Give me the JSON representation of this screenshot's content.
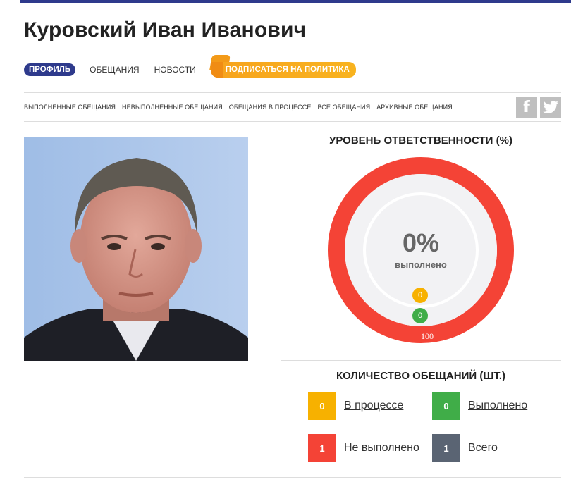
{
  "profile": {
    "name": "Куровский Иван Иванович"
  },
  "main_nav": {
    "active": "ПРОФИЛЬ",
    "items": [
      "ОБЕЩАНИЯ",
      "НОВОСТИ"
    ],
    "subscribe": "ПОДПИСАТЬСЯ НА ПОЛИТИКА"
  },
  "sub_nav": [
    "ВЫПОЛНЕННЫЕ ОБЕЩАНИЯ",
    "НЕВЫПОЛНЕННЫЕ ОБЕЩАНИЯ",
    "ОБЕЩАНИЯ В ПРОЦЕССЕ",
    "ВСЕ ОБЕЩАНИЯ",
    "АРХИВНЫЕ ОБЕЩАНИЯ"
  ],
  "social": {
    "facebook_icon": "facebook-icon",
    "twitter_icon": "twitter-icon"
  },
  "responsibility": {
    "title": "УРОВЕНЬ ОТВЕТСТВЕННОСТИ (%)",
    "percent": "0%",
    "percent_label": "выполнено",
    "in_process": "0",
    "done": "0",
    "not_done_share": "100"
  },
  "counts": {
    "title": "КОЛИЧЕСТВО ОБЕЩАНИЙ (ШТ.)",
    "in_process": {
      "value": "0",
      "label": "В процессе"
    },
    "done": {
      "value": "0",
      "label": "Выполнено"
    },
    "not_done": {
      "value": "1",
      "label": "Не выполнено"
    },
    "total": {
      "value": "1",
      "label": "Всего"
    }
  },
  "colors": {
    "brand": "#2e3a8c",
    "accent_orange": "#f7a31e",
    "in_process": "#f7b100",
    "done": "#40ad48",
    "not_done": "#f44336",
    "total": "#5a6473"
  }
}
